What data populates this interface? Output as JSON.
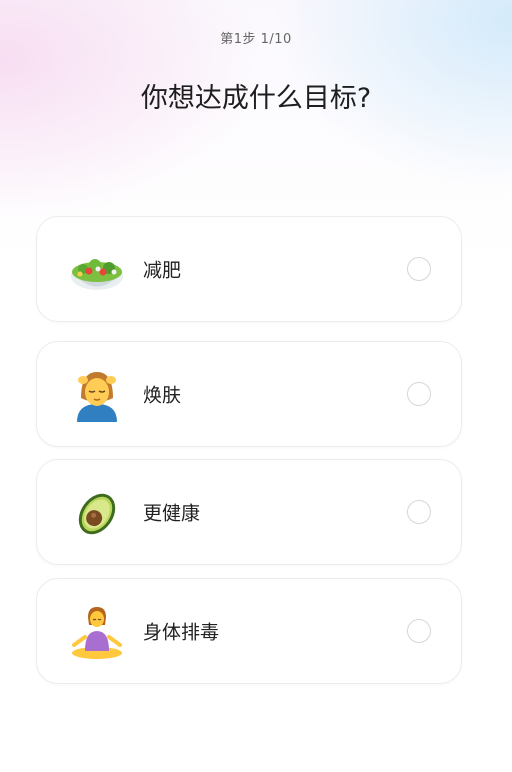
{
  "header": {
    "step": "第1步 1/10",
    "title": "你想达成什么目标?"
  },
  "options": [
    {
      "label": "减肥",
      "icon": "salad-icon",
      "selected": false
    },
    {
      "label": "焕肤",
      "icon": "face-massage-icon",
      "selected": false
    },
    {
      "label": "更健康",
      "icon": "avocado-icon",
      "selected": false
    },
    {
      "label": "身体排毒",
      "icon": "yoga-icon",
      "selected": false
    }
  ],
  "colors": {
    "title": "#1e1e1e",
    "card_border": "#ececec",
    "radio_border": "#d6d6d6"
  }
}
